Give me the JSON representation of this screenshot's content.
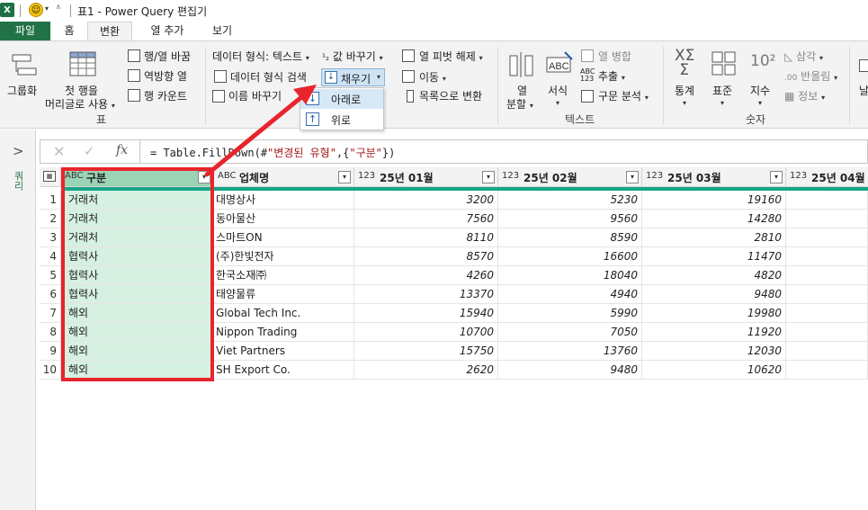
{
  "window": {
    "title": "표1 - Power Query 편집기"
  },
  "tabs": [
    "파일",
    "홈",
    "변환",
    "열 추가",
    "보기"
  ],
  "ribbon": {
    "table_group": {
      "group_by": "그룹화",
      "first_row_header_1": "첫 행을",
      "first_row_header_2": "머리글로 사용",
      "transpose": "행/열 바꿈",
      "reverse_rows": "역방향 열",
      "count_rows": "행 카운트",
      "label": "표"
    },
    "any_column_group": {
      "data_type": "데이터 형식: 텍스트",
      "detect_type": "데이터 형식 검색",
      "rename": "이름 바꾸기",
      "replace_values": "값 바꾸기",
      "fill": "채우기",
      "unpivot": "열 피벗 해제",
      "move": "이동",
      "convert_to_list": "목록으로 변환"
    },
    "text_group": {
      "split_column_1": "열",
      "split_column_2": "분할",
      "format": "서식",
      "merge_columns": "열 병합",
      "extract": "추출",
      "parse": "구문 분석",
      "label": "텍스트"
    },
    "number_group": {
      "statistics": "통계",
      "standard": "표준",
      "scientific": "지수",
      "trigonometry": "삼각",
      "rounding": "반올림",
      "information": "정보",
      "label": "숫자"
    },
    "extra": "날"
  },
  "fill_menu": {
    "down": "아래로",
    "up": "위로"
  },
  "query_pane": {
    "label": "쿼리"
  },
  "formula_bar": {
    "prefix": "= Table.FillDown(#",
    "arg1": "\"변경된 유형\"",
    "mid": ",{",
    "arg2": "\"구분\"",
    "suffix": "})"
  },
  "table": {
    "columns": [
      {
        "type": "ABC",
        "name": "구분"
      },
      {
        "type": "ABC",
        "name": "업체명"
      },
      {
        "type": "123",
        "name": "25년 01월"
      },
      {
        "type": "123",
        "name": "25년 02월"
      },
      {
        "type": "123",
        "name": "25년 03월"
      },
      {
        "type": "123",
        "name": "25년 04월"
      }
    ],
    "rows": [
      {
        "n": "1",
        "category": "거래처",
        "company": "대명상사",
        "m1": "3200",
        "m2": "5230",
        "m3": "19160"
      },
      {
        "n": "2",
        "category": "거래처",
        "company": "동아물산",
        "m1": "7560",
        "m2": "9560",
        "m3": "14280"
      },
      {
        "n": "3",
        "category": "거래처",
        "company": "스마트ON",
        "m1": "8110",
        "m2": "8590",
        "m3": "2810"
      },
      {
        "n": "4",
        "category": "협력사",
        "company": "(주)한빛전자",
        "m1": "8570",
        "m2": "16600",
        "m3": "11470"
      },
      {
        "n": "5",
        "category": "협력사",
        "company": "한국소재㈜",
        "m1": "4260",
        "m2": "18040",
        "m3": "4820"
      },
      {
        "n": "6",
        "category": "협력사",
        "company": "태양물류",
        "m1": "13370",
        "m2": "4940",
        "m3": "9480"
      },
      {
        "n": "7",
        "category": "해외",
        "company": "Global Tech Inc.",
        "m1": "15940",
        "m2": "5990",
        "m3": "19980"
      },
      {
        "n": "8",
        "category": "해외",
        "company": "Nippon Trading",
        "m1": "10700",
        "m2": "7050",
        "m3": "11920"
      },
      {
        "n": "9",
        "category": "해외",
        "company": "Viet Partners",
        "m1": "15750",
        "m2": "13760",
        "m3": "12030"
      },
      {
        "n": "10",
        "category": "해외",
        "company": "SH Export Co.",
        "m1": "2620",
        "m2": "9480",
        "m3": "10620"
      }
    ]
  },
  "colors": {
    "excel_green": "#217346",
    "selected_header": "#9bd3b5",
    "selected_cells": "#d6f0e2",
    "annotation_red": "#e8252b"
  }
}
